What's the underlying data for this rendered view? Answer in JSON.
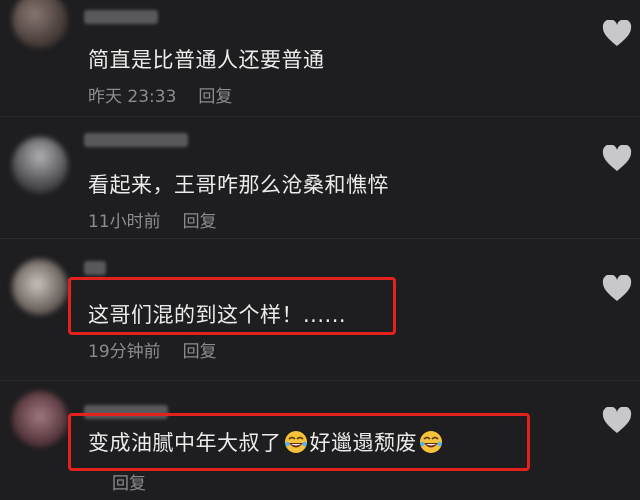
{
  "comments": [
    {
      "text": "简直是比普通人还要普通",
      "time": "昨天 23:33",
      "reply": "回复"
    },
    {
      "text": "看起来，王哥咋那么沧桑和憔悴",
      "time": "11小时前",
      "reply": "回复"
    },
    {
      "text": "这哥们混的到这个样！......",
      "time": "19分钟前",
      "reply": "回复"
    },
    {
      "text_a": "变成油腻中年大叔了",
      "text_b": "好邋遢颓废",
      "emoji_name": "rofl-emoji",
      "time": "",
      "reply": "回复"
    }
  ],
  "colors": {
    "highlight_box": "#e4221d",
    "text": "#ececec",
    "meta": "#8c8c90",
    "heart": "#c8c8ca"
  },
  "icons": {
    "like": "heart-icon",
    "emoji": "rofl-emoji"
  }
}
